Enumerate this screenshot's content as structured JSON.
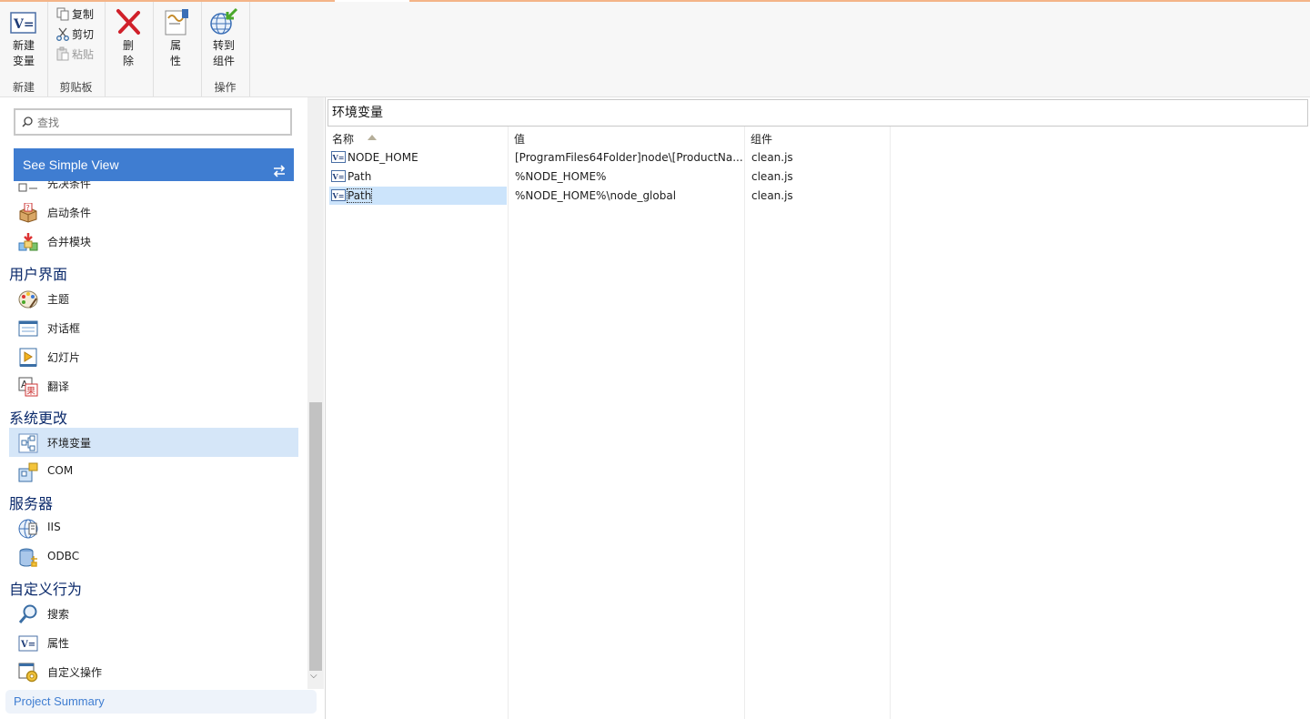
{
  "ribbon": {
    "groups": [
      {
        "label": "新建",
        "buttons": [
          {
            "label": "新建\n变量",
            "icon": "new-variable-icon"
          }
        ]
      },
      {
        "label": "剪贴板",
        "buttons": [
          {
            "label": "复制",
            "icon": "copy-icon",
            "enabled": true
          },
          {
            "label": "剪切",
            "icon": "cut-icon",
            "enabled": true
          },
          {
            "label": "粘贴",
            "icon": "paste-icon",
            "enabled": false
          }
        ]
      },
      {
        "label": "",
        "buttons": [
          {
            "label": "删\n除",
            "icon": "delete-icon"
          }
        ]
      },
      {
        "label": "",
        "buttons": [
          {
            "label": "属\n性",
            "icon": "properties-icon"
          }
        ]
      },
      {
        "label": "操作",
        "buttons": [
          {
            "label": "转到\n组件",
            "icon": "goto-component-icon"
          }
        ]
      }
    ],
    "new_line1": "新建",
    "new_line2": "变量",
    "copy": "复制",
    "cut": "剪切",
    "paste": "粘贴",
    "delete_line1": "删",
    "delete_line2": "除",
    "props_line1": "属",
    "props_line2": "性",
    "goto_line1": "转到",
    "goto_line2": "组件",
    "group_new": "新建",
    "group_clipboard": "剪贴板",
    "group_ops": "操作"
  },
  "sidebar": {
    "search_placeholder": "查找",
    "simple_view": "See Simple View",
    "partial_item": "先决条件",
    "items": [
      {
        "label": "启动条件",
        "icon": "launch-conditions-icon"
      },
      {
        "label": "合并模块",
        "icon": "merge-modules-icon"
      }
    ],
    "section_ui": "用户界面",
    "ui_items": [
      {
        "label": "主题",
        "icon": "theme-palette-icon"
      },
      {
        "label": "对话框",
        "icon": "dialog-icon"
      },
      {
        "label": "幻灯片",
        "icon": "slideshow-icon"
      },
      {
        "label": "翻译",
        "icon": "translation-icon"
      }
    ],
    "section_system": "系统更改",
    "system_items": [
      {
        "label": "环境变量",
        "icon": "environment-variables-icon",
        "selected": true
      },
      {
        "label": "COM",
        "icon": "com-icon"
      }
    ],
    "section_server": "服务器",
    "server_items": [
      {
        "label": "IIS",
        "icon": "iis-globe-icon"
      },
      {
        "label": "ODBC",
        "icon": "odbc-database-icon"
      }
    ],
    "section_custom": "自定义行为",
    "custom_items": [
      {
        "label": "搜索",
        "icon": "search-magnifier-icon"
      },
      {
        "label": "属性",
        "icon": "property-variable-icon"
      },
      {
        "label": "自定义操作",
        "icon": "custom-action-gear-icon"
      }
    ],
    "project_summary": "Project Summary"
  },
  "main": {
    "title": "环境变量",
    "columns": [
      "名称",
      "值",
      "组件"
    ],
    "rows": [
      {
        "name": "NODE_HOME",
        "value": "[ProgramFiles64Folder]node\\[ProductNa...",
        "component": "clean.js"
      },
      {
        "name": "Path",
        "value": "%NODE_HOME%",
        "component": "clean.js"
      },
      {
        "name": "Path",
        "value": "%NODE_HOME%\\node_global",
        "component": "clean.js",
        "selected": true
      }
    ]
  },
  "colors": {
    "accent": "#3f7dd1",
    "selection": "#d5e6f8",
    "heading": "#0b2a6b",
    "top_accent": "#f4b488"
  }
}
